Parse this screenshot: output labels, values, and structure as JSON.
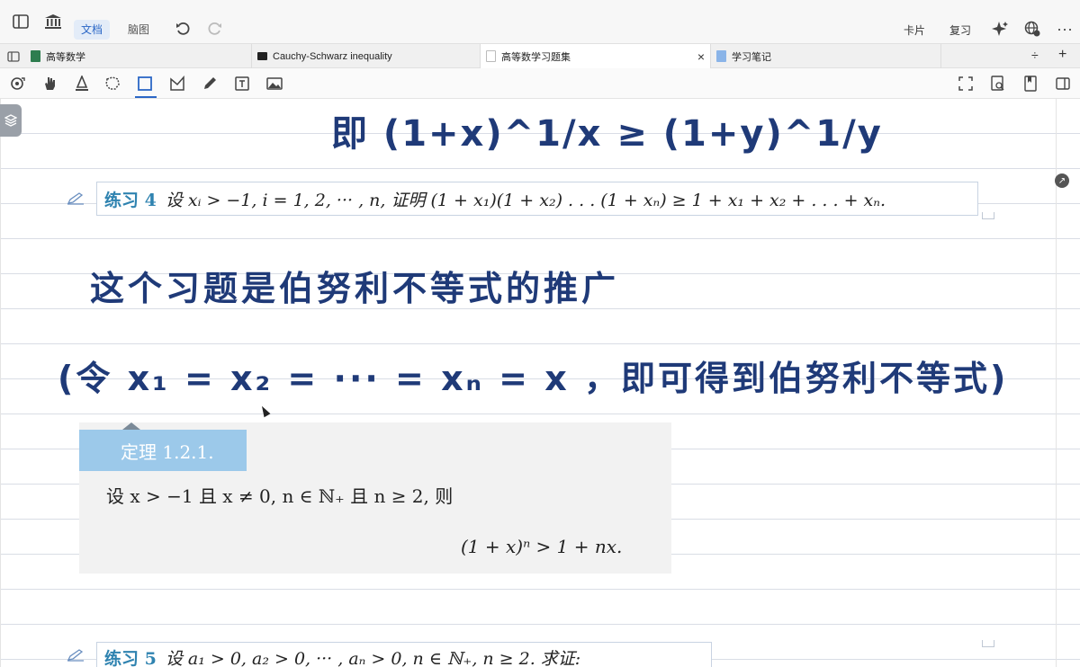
{
  "toolbar": {
    "modes": [
      {
        "label": "文档",
        "active": true
      },
      {
        "label": "脑图",
        "active": false
      }
    ],
    "right_buttons": [
      "卡片",
      "复习"
    ],
    "icons": [
      "sidebar-toggle-icon",
      "library-icon",
      "undo-icon",
      "redo-icon",
      "ai-sparkle-icon",
      "translate-icon",
      "more-icon"
    ]
  },
  "tabs": [
    {
      "title": "高等数学",
      "color": "#2e7d4f",
      "active": false
    },
    {
      "title": "Cauchy-Schwarz inequality",
      "color": "#222222",
      "active": false
    },
    {
      "title": "高等数学习题集",
      "color": "#ffffff",
      "active": true
    },
    {
      "title": "学习笔记",
      "color": "#8ab4e8",
      "active": false
    }
  ],
  "tabbar_actions": {
    "close": "×",
    "dropdown": "÷",
    "add": "+"
  },
  "annotation_tools": [
    "rotate-icon",
    "hand-icon",
    "highlight-icon",
    "lasso-icon",
    "rectangle-select-icon",
    "shape-icon",
    "pen-icon",
    "textbox-icon",
    "image-icon"
  ],
  "annotation_right": [
    "fullscreen-icon",
    "search-doc-icon",
    "bookmark-icon",
    "sidebar-right-icon"
  ],
  "content": {
    "handwriting_1": "即 (1+x)^1/x ≥ (1+y)^1/y",
    "exercise4": {
      "label": "练习 4",
      "text": "设 xᵢ > −1, i = 1, 2, ··· , n, 证明 (1 + x₁)(1 + x₂) . . . (1 + xₙ) ≥ 1 + x₁ + x₂ + . . . + xₙ."
    },
    "handwriting_2": "这个习题是伯努利不等式的推广",
    "handwriting_3": "(令 x₁ = x₂ = ··· = xₙ = x ，即可得到伯努利不等式)",
    "theorem": {
      "label": "定理 1.2.1.",
      "line1": "设 x > −1 且 x ≠ 0, n ∈ ℕ₊ 且 n ≥ 2, 则",
      "line2": "(1 + x)ⁿ > 1 + nx."
    },
    "exercise5": {
      "label": "练习 5",
      "text": "设 a₁ > 0, a₂ > 0, ··· , aₙ > 0, n ∈ ℕ₊, n ≥ 2. 求证:"
    }
  }
}
